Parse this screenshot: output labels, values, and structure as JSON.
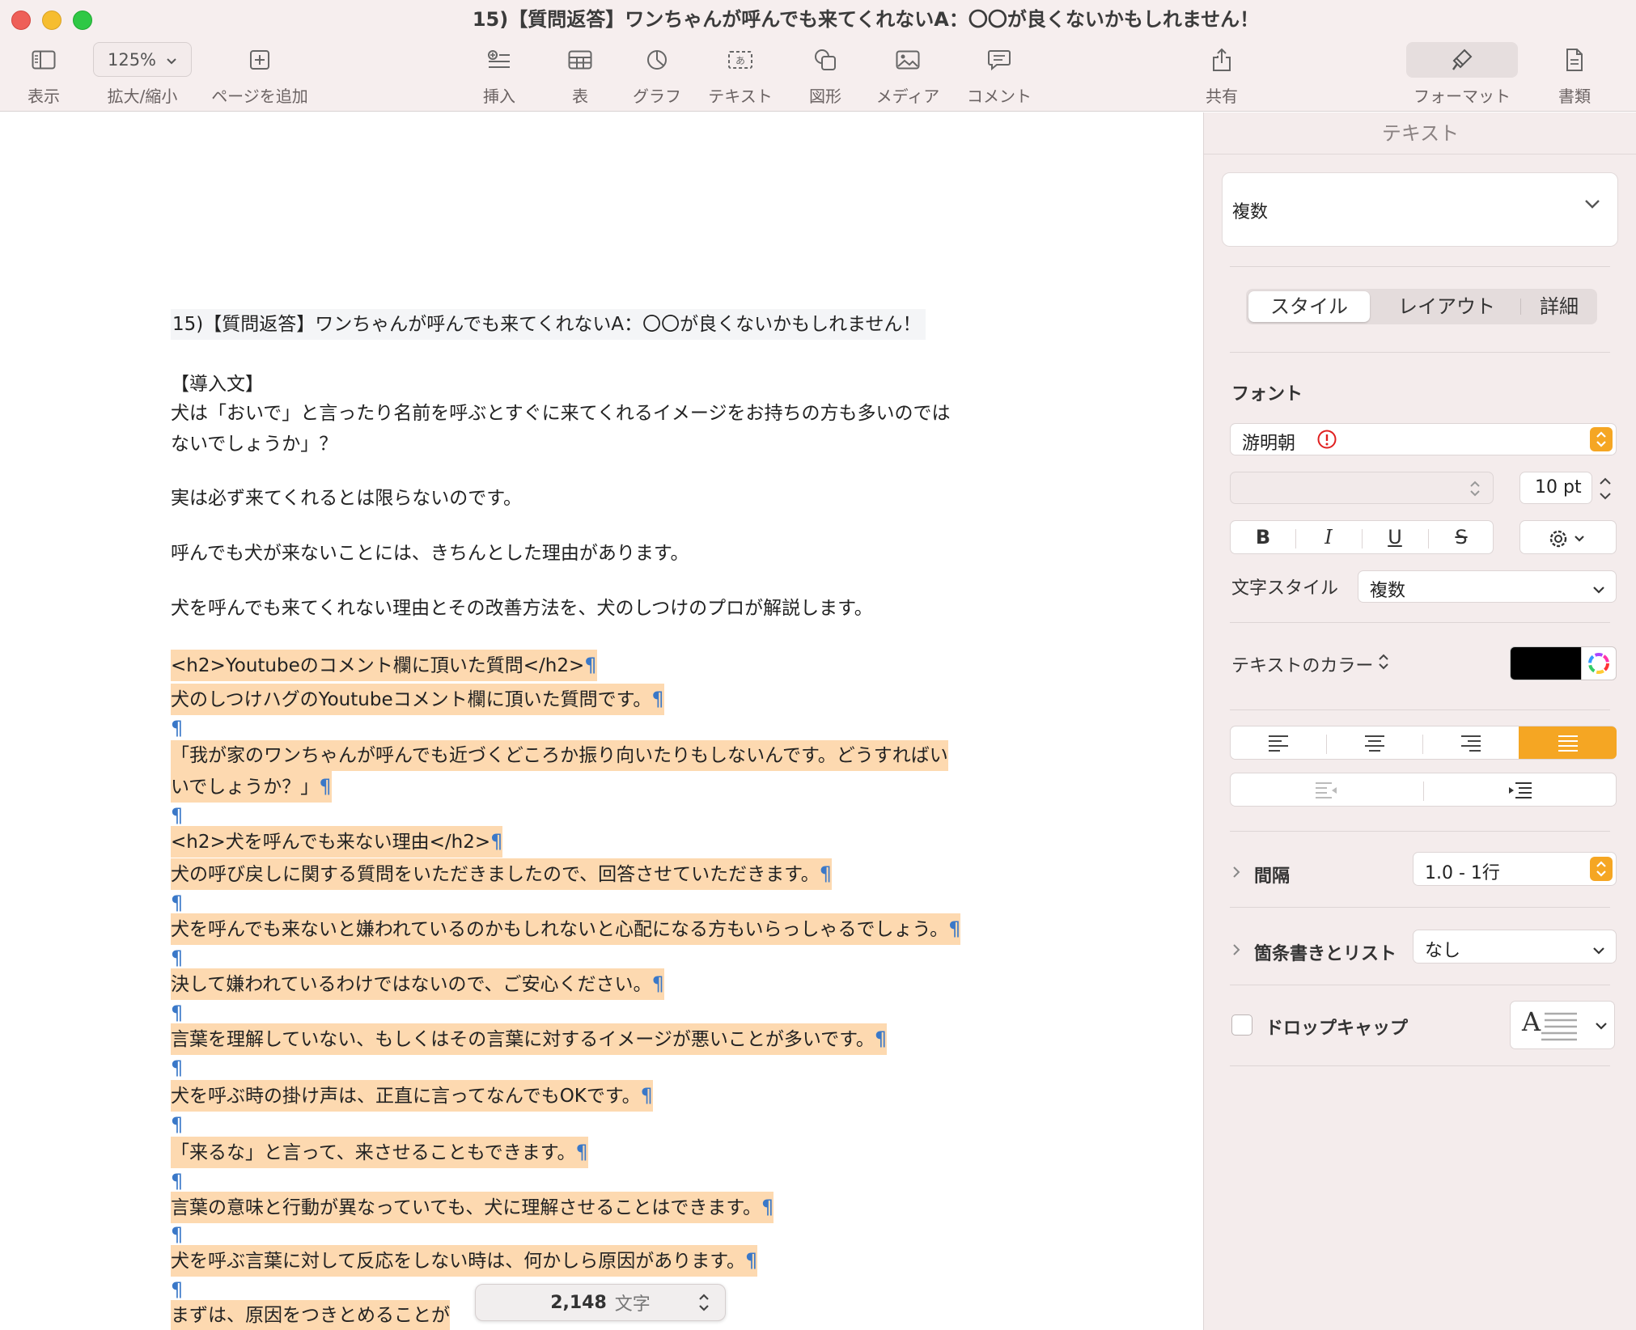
{
  "window": {
    "title": "15)【質問返答】ワンちゃんが呼んでも来てくれないA：〇〇が良くないかもしれません！"
  },
  "toolbar": {
    "view": "表示",
    "zoom_value": "125%",
    "zoom": "拡大/縮小",
    "add_page": "ページを追加",
    "insert": "挿入",
    "table": "表",
    "chart": "グラフ",
    "text": "テキスト",
    "shape": "図形",
    "media": "メディア",
    "comment": "コメント",
    "share": "共有",
    "format": "フォーマット",
    "document": "書類"
  },
  "document": {
    "title_line": "15)【質問返答】ワンちゃんが呼んでも来てくれないA：〇〇が良くないかもしれません！",
    "intro_heading": "【導入文】",
    "intro_1a": "犬は「おいで」と言ったり名前を呼ぶとすぐに来てくれるイメージをお持ちの方も多いのでは",
    "intro_1b": "ないでしょうか」？",
    "intro_2": "実は必ず来てくれるとは限らないのです。",
    "intro_3": "呼んでも犬が来ないことには、きちんとした理由があります。",
    "intro_4": "犬を呼んでも来てくれない理由とその改善方法を、犬のしつけのプロが解説します。",
    "pilcrow": "¶",
    "hl": [
      "<h2>Youtubeのコメント欄に頂いた質問</h2>",
      "犬のしつけハグのYoutubeコメント欄に頂いた質問です。",
      "「我が家のワンちゃんが呼んでも近づくどころか振り向いたりもしないんです。どうすればい",
      "いでしょうか？」",
      "<h2>犬を呼んでも来ない理由</h2>",
      "犬の呼び戻しに関する質問をいただきましたので、回答させていただきます。",
      "犬を呼んでも来ないと嫌われているのかもしれないと心配になる方もいらっしゃるでしょう。",
      "決して嫌われているわけではないので、ご安心ください。",
      "言葉を理解していない、もしくはその言葉に対するイメージが悪いことが多いです。",
      "犬を呼ぶ時の掛け声は、正直に言ってなんでもOKです。",
      "「来るな」と言って、来させることもできます。",
      "言葉の意味と行動が異なっていても、犬に理解させることはできます。",
      "犬を呼ぶ言葉に対して反応をしない時は、何かしら原因があります。",
      "まずは、原因をつきとめることが"
    ]
  },
  "word_count": {
    "value": "2,148",
    "unit": "文字"
  },
  "inspector": {
    "header": "テキスト",
    "paragraph_style": "複数",
    "tabs": [
      "スタイル",
      "レイアウト",
      "詳細"
    ],
    "font_label": "フォント",
    "font_name": "游明朝",
    "font_size": "10 pt",
    "bold": "B",
    "italic": "I",
    "underline": "U",
    "strike": "S",
    "char_style_label": "文字スタイル",
    "char_style_value": "複数",
    "text_color_label": "テキストのカラー",
    "spacing_label": "間隔",
    "spacing_value": "1.0 - 1行",
    "bullets_label": "箇条書きとリスト",
    "bullets_value": "なし",
    "dropcap_label": "ドロップキャップ",
    "dropcap_preview": "A",
    "text_color": "#000000",
    "accent_color": "#f5a623"
  }
}
